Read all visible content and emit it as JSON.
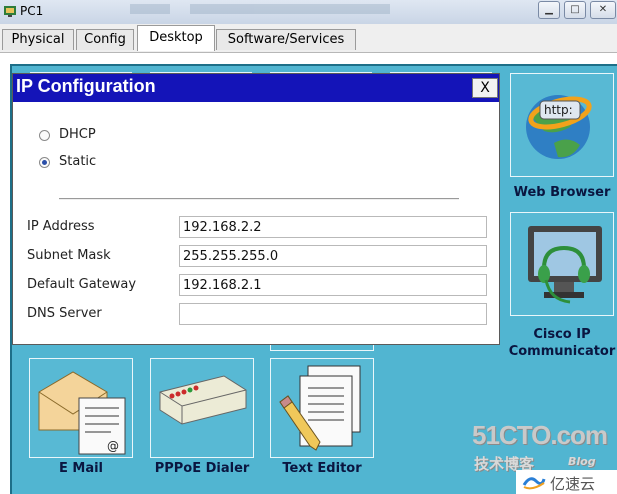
{
  "window": {
    "title": "PC1"
  },
  "tabs": [
    {
      "label": "Physical"
    },
    {
      "label": "Config"
    },
    {
      "label": "Desktop"
    },
    {
      "label": "Software/Services"
    }
  ],
  "active_tab": "Desktop",
  "ip_config": {
    "title": "IP Configuration",
    "close_label": "X",
    "mode_options": [
      {
        "label": "DHCP",
        "selected": false
      },
      {
        "label": "Static",
        "selected": true
      }
    ],
    "fields": [
      {
        "label": "IP Address",
        "value": "192.168.2.2"
      },
      {
        "label": "Subnet Mask",
        "value": "255.255.255.0"
      },
      {
        "label": "Default Gateway",
        "value": "192.168.2.1"
      },
      {
        "label": "DNS Server",
        "value": ""
      }
    ]
  },
  "apps": {
    "web_browser": {
      "label": "Web Browser",
      "icon_text": "http:"
    },
    "cisco_ip_communicator": {
      "label": "Cisco IP Communicator"
    },
    "email": {
      "label": "E Mail"
    },
    "pppoe_dialer": {
      "label": "PPPoE Dialer"
    },
    "text_editor": {
      "label": "Text Editor"
    }
  },
  "watermark": {
    "site": "51CTO.com",
    "caption": "技术博客",
    "blog": "Blog",
    "brand": "亿速云"
  },
  "colors": {
    "desktop_bg": "#51b5d1",
    "dialog_header": "#1414b8",
    "label_text": "#0a1640"
  }
}
